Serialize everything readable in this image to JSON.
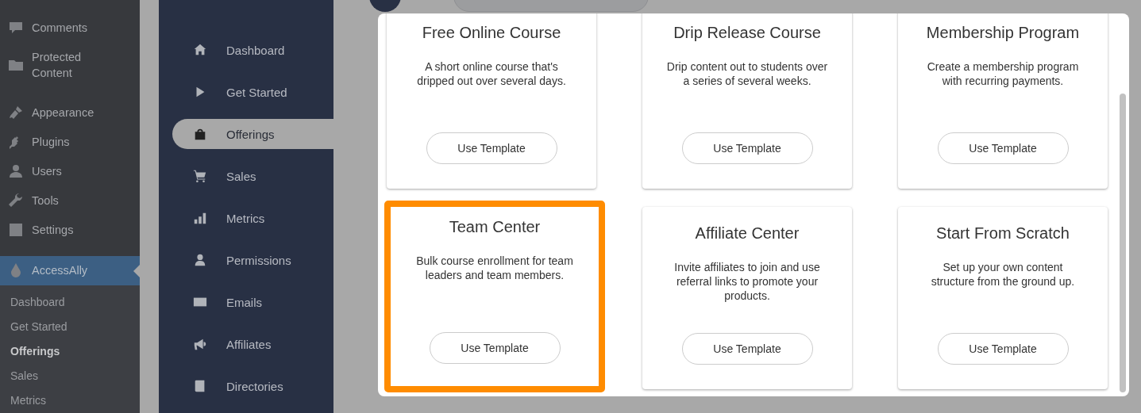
{
  "wp_menu": {
    "items": [
      {
        "label": "Comments",
        "selected": false
      },
      {
        "label": "Protected Content",
        "selected": false
      },
      {
        "label": "Appearance",
        "selected": false
      },
      {
        "label": "Plugins",
        "selected": false
      },
      {
        "label": "Users",
        "selected": false
      },
      {
        "label": "Tools",
        "selected": false
      },
      {
        "label": "Settings",
        "selected": false
      },
      {
        "label": "AccessAlly",
        "selected": true
      }
    ],
    "submenu": [
      {
        "label": "Dashboard",
        "selected": false
      },
      {
        "label": "Get Started",
        "selected": false
      },
      {
        "label": "Offerings",
        "selected": true
      },
      {
        "label": "Sales",
        "selected": false
      },
      {
        "label": "Metrics",
        "selected": false
      }
    ]
  },
  "app_nav": {
    "items": [
      {
        "label": "Dashboard",
        "selected": false
      },
      {
        "label": "Get Started",
        "selected": false
      },
      {
        "label": "Offerings",
        "selected": true
      },
      {
        "label": "Sales",
        "selected": false
      },
      {
        "label": "Metrics",
        "selected": false
      },
      {
        "label": "Permissions",
        "selected": false
      },
      {
        "label": "Emails",
        "selected": false
      },
      {
        "label": "Affiliates",
        "selected": false
      },
      {
        "label": "Directories",
        "selected": false
      }
    ]
  },
  "template_modal": {
    "templates": [
      {
        "title": "Free Online Course",
        "description": "A short online course that's dripped out over several days.",
        "button": "Use Template",
        "highlighted": false
      },
      {
        "title": "Drip Release Course",
        "description": "Drip content out to students over a series of several weeks.",
        "button": "Use Template",
        "highlighted": false
      },
      {
        "title": "Membership Program",
        "description": "Create a membership program with recurring payments.",
        "button": "Use Template",
        "highlighted": false
      },
      {
        "title": "Team Center",
        "description": "Bulk course enrollment for team leaders and team members.",
        "button": "Use Template",
        "highlighted": true
      },
      {
        "title": "Affiliate Center",
        "description": "Invite affiliates to join and use referral links to promote your products.",
        "button": "Use Template",
        "highlighted": false
      },
      {
        "title": "Start From Scratch",
        "description": "Set up your own content structure from the ground up.",
        "button": "Use Template",
        "highlighted": false
      }
    ]
  }
}
